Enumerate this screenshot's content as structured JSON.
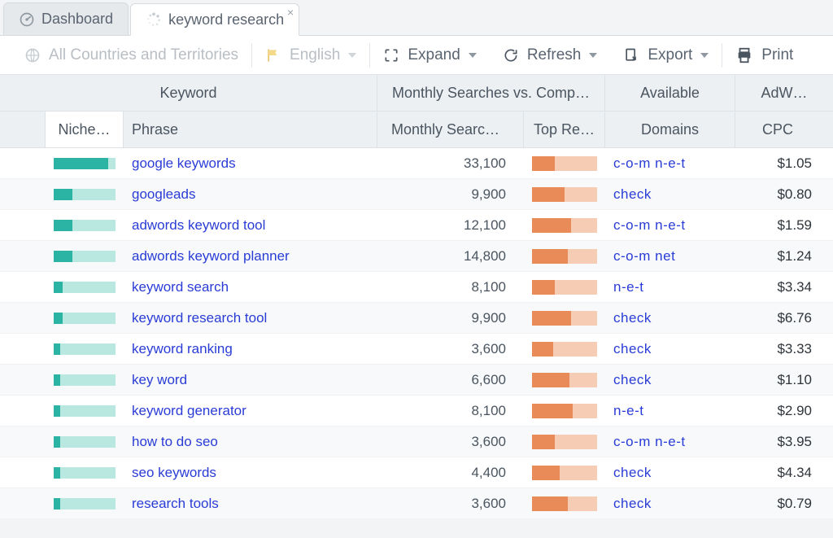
{
  "tabs": [
    {
      "label": "Dashboard",
      "icon": "gauge-icon",
      "active": false
    },
    {
      "label": "keyword research",
      "icon": "spinner-icon",
      "active": true
    }
  ],
  "toolbar": {
    "countries": {
      "label": "All Countries and Territories",
      "disabled": true
    },
    "language": {
      "label": "English",
      "disabled": true
    },
    "expand": "Expand",
    "refresh": "Refresh",
    "export": "Export",
    "print": "Print"
  },
  "columns": {
    "groups": {
      "keyword": "Keyword",
      "monthly": "Monthly Searches vs. Comp…",
      "available": "Available",
      "adwords": "AdW…"
    },
    "sub": {
      "niche": "Niche…",
      "phrase": "Phrase",
      "monthly_searches": "Monthly Searc…",
      "top_results": "Top Re…",
      "domains": "Domains",
      "cpc": "CPC"
    }
  },
  "rows": [
    {
      "niche_pct": 88,
      "phrase": "google keywords",
      "searches": "33,100",
      "top_pct": 35,
      "domains": "c-o-m n-e-t",
      "cpc": "$1.05"
    },
    {
      "niche_pct": 30,
      "phrase": "googleads",
      "searches": "9,900",
      "top_pct": 50,
      "domains": "check",
      "cpc": "$0.80"
    },
    {
      "niche_pct": 30,
      "phrase": "adwords keyword tool",
      "searches": "12,100",
      "top_pct": 60,
      "domains": "c-o-m n-e-t",
      "cpc": "$1.59"
    },
    {
      "niche_pct": 30,
      "phrase": "adwords keyword planner",
      "searches": "14,800",
      "top_pct": 55,
      "domains": "c-o-m net",
      "cpc": "$1.24"
    },
    {
      "niche_pct": 15,
      "phrase": "keyword search",
      "searches": "8,100",
      "top_pct": 35,
      "domains": "n-e-t",
      "cpc": "$3.34"
    },
    {
      "niche_pct": 15,
      "phrase": "keyword research tool",
      "searches": "9,900",
      "top_pct": 60,
      "domains": "check",
      "cpc": "$6.76"
    },
    {
      "niche_pct": 10,
      "phrase": "keyword ranking",
      "searches": "3,600",
      "top_pct": 32,
      "domains": "check",
      "cpc": "$3.33"
    },
    {
      "niche_pct": 10,
      "phrase": "key word",
      "searches": "6,600",
      "top_pct": 58,
      "domains": "check",
      "cpc": "$1.10"
    },
    {
      "niche_pct": 10,
      "phrase": "keyword generator",
      "searches": "8,100",
      "top_pct": 62,
      "domains": "n-e-t",
      "cpc": "$2.90"
    },
    {
      "niche_pct": 10,
      "phrase": "how to do seo",
      "searches": "3,600",
      "top_pct": 35,
      "domains": "c-o-m n-e-t",
      "cpc": "$3.95"
    },
    {
      "niche_pct": 10,
      "phrase": "seo keywords",
      "searches": "4,400",
      "top_pct": 42,
      "domains": "check",
      "cpc": "$4.34"
    },
    {
      "niche_pct": 10,
      "phrase": "research tools",
      "searches": "3,600",
      "top_pct": 55,
      "domains": "check",
      "cpc": "$0.79"
    }
  ]
}
